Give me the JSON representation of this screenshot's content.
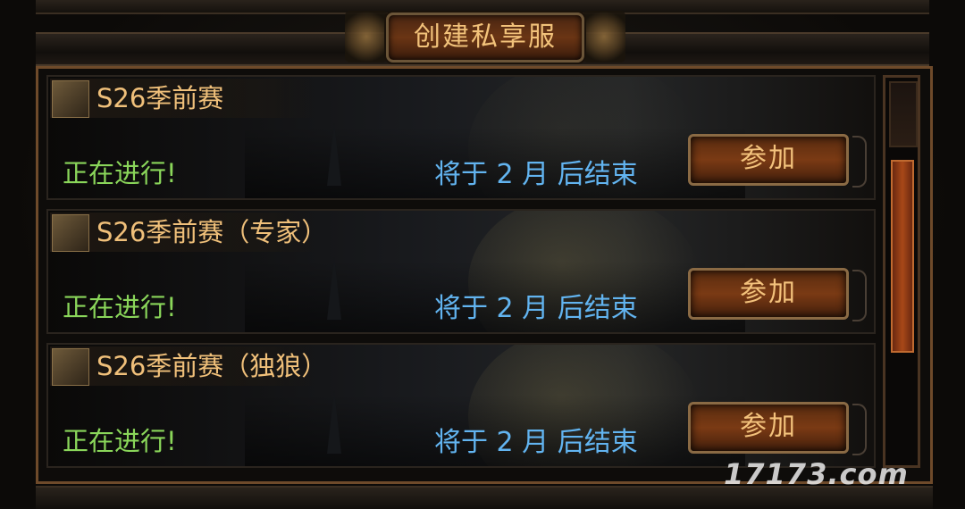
{
  "header": {
    "create_label": "创建私享服"
  },
  "entries": [
    {
      "title": "S26季前赛",
      "status": "正在进行!",
      "ends_in": "将于 2 月 后结束",
      "join_label": "参加"
    },
    {
      "title": "S26季前赛（专家）",
      "status": "正在进行!",
      "ends_in": "将于 2 月 后结束",
      "join_label": "参加"
    },
    {
      "title": "S26季前赛（独狼）",
      "status": "正在进行!",
      "ends_in": "将于 2 月 后结束",
      "join_label": "参加"
    }
  ],
  "watermark": "17173.com",
  "colors": {
    "title": "#f0c07a",
    "status": "#8ad65a",
    "ends": "#62b4f0",
    "button_text": "#f3c27c"
  }
}
